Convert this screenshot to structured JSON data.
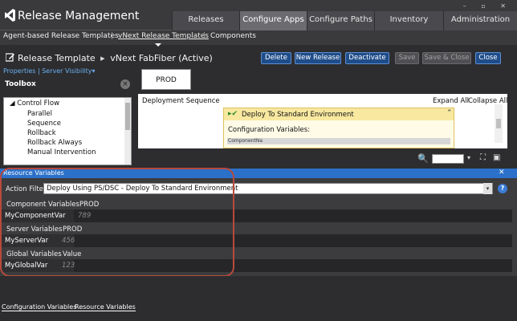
{
  "app": {
    "title": "Release Management",
    "window_controls": "– ▫ ✕"
  },
  "tabs": [
    {
      "label": "Releases",
      "active": false
    },
    {
      "label": "Configure Apps",
      "active": true
    },
    {
      "label": "Configure Paths",
      "active": false
    },
    {
      "label": "Inventory",
      "active": false
    },
    {
      "label": "Administration",
      "active": false
    }
  ],
  "subnav": {
    "items": [
      "Agent-based Release Templates",
      "vNext Release Templates",
      "Components"
    ],
    "separator": "|"
  },
  "header": {
    "title": "Release Template",
    "breadcrumb_arrow": "▸",
    "subtitle": "vNext FabFiber (Active)",
    "links": "Properties | Server Visibility▾"
  },
  "buttons": {
    "delete": "Delete",
    "new_release": "New Release",
    "deactivate": "Deactivate",
    "save": "Save",
    "save_close": "Save & Close",
    "close": "Close"
  },
  "toolbox": {
    "title": "Toolbox",
    "close_glyph": "×",
    "items": [
      {
        "label": "◢ Control Flow",
        "indent": 0
      },
      {
        "label": "Parallel",
        "indent": 1
      },
      {
        "label": "Sequence",
        "indent": 1
      },
      {
        "label": "Rollback",
        "indent": 1
      },
      {
        "label": "Rollback Always",
        "indent": 1
      },
      {
        "label": "Manual Intervention",
        "indent": 1
      }
    ]
  },
  "designer": {
    "stage": "PROD",
    "deployment_sequence": "Deployment Sequence",
    "expand_all": "Expand All",
    "collapse_all": "Collapse All",
    "activity_title": "Deploy To Standard Environment",
    "activity_icon": "▸✔",
    "activity_collapse": "⌃",
    "config_vars_label": "Configuration Variables:",
    "config_vars_row": "ComponentNa",
    "zoom_icon": "🔍",
    "zoom_drop": "▾",
    "fit_icon": "⛶",
    "overview_icon": "▣"
  },
  "resource_variables": {
    "title": "Resource Variables",
    "close_glyph": "✕",
    "action_filter_label": "Action Filter",
    "action_filter_value": "Deploy Using PS/DSC - Deploy To Standard Environment",
    "dropdown_glyph": "▾",
    "help_glyph": "?",
    "sections": [
      {
        "header": "Component Variables",
        "col": "PROD",
        "name": "MyComponentVar",
        "value": "789"
      },
      {
        "header": "Server Variables",
        "col": "PROD",
        "name": "MyServerVar",
        "value": "456"
      },
      {
        "header": "Global Variables",
        "col": "Value",
        "name": "MyGlobalVar",
        "value": "123"
      }
    ]
  },
  "bottom_tabs": [
    "Configuration Variables",
    "Resource Variables"
  ],
  "colors": {
    "accent": "#2b70c9",
    "button": "#1f4d8a",
    "highlight": "#b84a3c"
  }
}
